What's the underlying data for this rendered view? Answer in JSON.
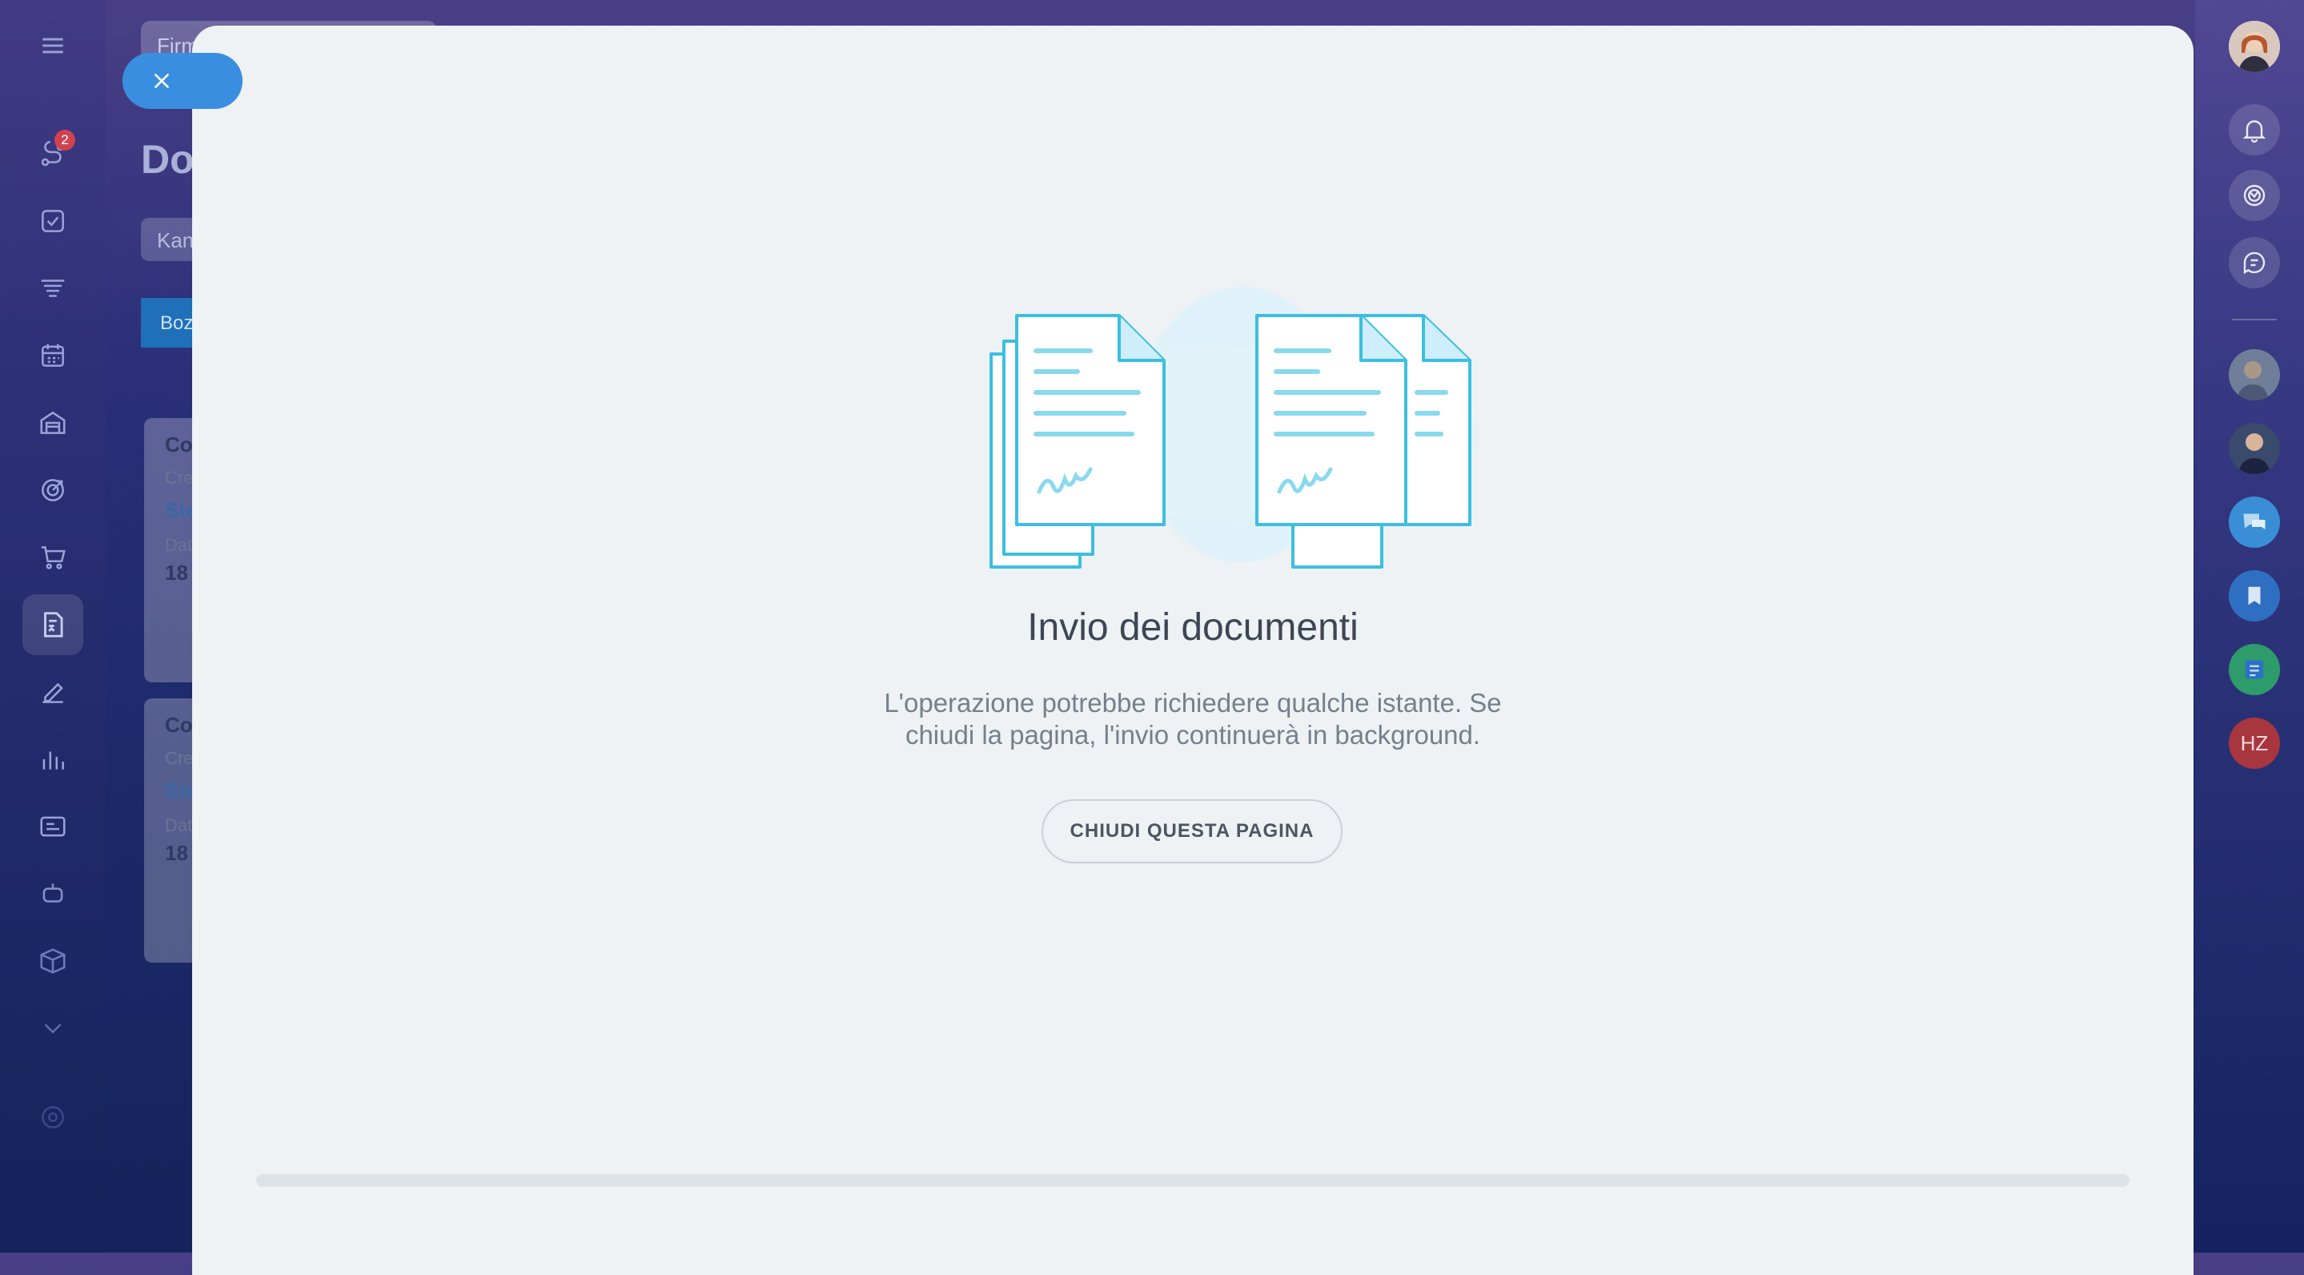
{
  "background_page": {
    "search_placeholder": "Firm",
    "title": "Do",
    "chip": "Kan",
    "column_label": "Boz",
    "cards": [
      {
        "title": "Co",
        "created": "Cre",
        "author": "Ste",
        "date_label": "Dat",
        "date": "18"
      },
      {
        "title": "Co",
        "created": "Cre",
        "author": "Ste",
        "date_label": "Dat",
        "date": "18"
      }
    ]
  },
  "left_sidebar": {
    "menu_icon": "hamburger-menu-icon",
    "items": [
      {
        "icon": "flow-icon",
        "badge": "2"
      },
      {
        "icon": "tasks-checkbox-icon"
      },
      {
        "icon": "crm-funnel-icon"
      },
      {
        "icon": "calendar-icon"
      },
      {
        "icon": "warehouse-icon"
      },
      {
        "icon": "target-icon"
      },
      {
        "icon": "shopping-cart-icon"
      },
      {
        "icon": "document-sign-icon",
        "active": true
      },
      {
        "icon": "signature-pen-icon"
      },
      {
        "icon": "analytics-bars-icon"
      },
      {
        "icon": "contacts-card-icon"
      },
      {
        "icon": "robot-icon"
      },
      {
        "icon": "package-box-icon"
      },
      {
        "icon": "chevron-down-icon"
      },
      {
        "icon": "settings-gear-icon"
      }
    ]
  },
  "right_sidebar": {
    "controls": [
      "bell-icon",
      "copilot-icon",
      "chat-search-icon"
    ],
    "avatars": [
      {
        "type": "photo",
        "color": "#6f7f9a"
      },
      {
        "type": "photo",
        "color": "#3a4a6c"
      },
      {
        "type": "chat-icon",
        "color": "#3a8ed6"
      },
      {
        "type": "bookmark-icon",
        "color": "#2f6fc2"
      },
      {
        "type": "notes-icon",
        "color": "#2d9b6a"
      },
      {
        "type": "initials",
        "initials": "HZ",
        "color": "#a8363f"
      }
    ]
  },
  "modal": {
    "title": "Invio dei documenti",
    "text_line1": "L'operazione potrebbe richiedere qualche istante. Se",
    "text_line2": "chiudi la pagina, l'invio continuerà in background.",
    "button_label": "CHIUDI QUESTA PAGINA",
    "progress_fraction": 0
  },
  "colors": {
    "accent": "#3a8ee0",
    "illustration_stroke": "#3cbfe0",
    "modal_bg": "#eef2f4"
  }
}
